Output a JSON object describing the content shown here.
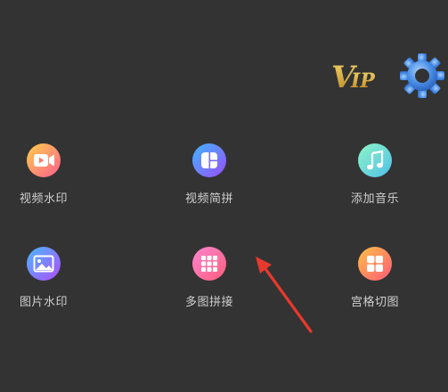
{
  "header": {
    "vip_badge": {
      "text": "VIP",
      "icon": "vip-badge-icon",
      "color": "#e2b43f"
    },
    "settings": {
      "icon": "gear-icon",
      "color": "#4a8fe8"
    }
  },
  "tools": [
    {
      "label": "视频水印",
      "icon": "video-camera-icon",
      "colors": [
        "#ffd04a",
        "#ff5d8f"
      ]
    },
    {
      "label": "视频简拼",
      "icon": "puzzle-square-icon",
      "colors": [
        "#3fb6ff",
        "#9b4dff"
      ]
    },
    {
      "label": "添加音乐",
      "icon": "music-note-icon",
      "colors": [
        "#7ef0d0",
        "#5cc9f0"
      ]
    },
    {
      "label": "图片水印",
      "icon": "image-icon",
      "colors": [
        "#4ab8ff",
        "#b04dff"
      ]
    },
    {
      "label": "多图拼接",
      "icon": "grid-icon",
      "colors": [
        "#ff7bc4",
        "#ff5d7c"
      ]
    },
    {
      "label": "宫格切图",
      "icon": "tiles-icon",
      "colors": [
        "#ffc046",
        "#ff5a78"
      ]
    }
  ],
  "annotation": {
    "icon": "red-arrow-icon",
    "color": "#e8392d"
  }
}
